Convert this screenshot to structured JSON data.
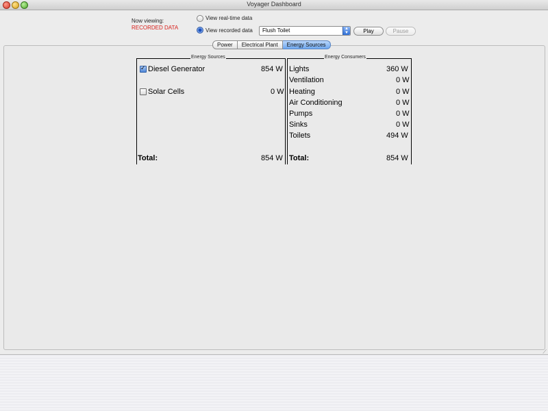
{
  "window": {
    "title": "Voyager Dashboard"
  },
  "status": {
    "now_label": "Now viewing:",
    "now_value": "RECORDED DATA"
  },
  "modes": {
    "realtime_label": "View real-time data",
    "recorded_label": "View recorded data",
    "selected": "recorded"
  },
  "recording_select": {
    "value": "Flush Toilet"
  },
  "buttons": {
    "play": "Play",
    "pause": "Pause"
  },
  "tabs": [
    {
      "label": "Power",
      "active": false
    },
    {
      "label": "Electrical Plant",
      "active": false
    },
    {
      "label": "Energy Sources",
      "active": true
    }
  ],
  "sources": {
    "title": "Energy Sources",
    "items": [
      {
        "name": "Diesel Generator",
        "value": "854 W",
        "checked": true
      },
      {
        "name": "Solar Cells",
        "value": "0 W",
        "checked": false
      }
    ],
    "total_label": "Total:",
    "total_value": "854 W"
  },
  "consumers": {
    "title": "Energy Consumers",
    "items": [
      {
        "name": "Lights",
        "value": "360 W"
      },
      {
        "name": "Ventilation",
        "value": "0 W"
      },
      {
        "name": "Heating",
        "value": "0 W"
      },
      {
        "name": "Air Conditioning",
        "value": "0 W"
      },
      {
        "name": "Pumps",
        "value": "0 W"
      },
      {
        "name": "Sinks",
        "value": "0 W"
      },
      {
        "name": "Toilets",
        "value": "494 W"
      }
    ],
    "total_label": "Total:",
    "total_value": "854 W"
  },
  "icons": {
    "select_arrows": "updown-arrows-icon",
    "resize": "resize-grip-icon"
  },
  "colors": {
    "recorded_indicator": "#d8201b",
    "active_tab": "#6ea7ef"
  }
}
